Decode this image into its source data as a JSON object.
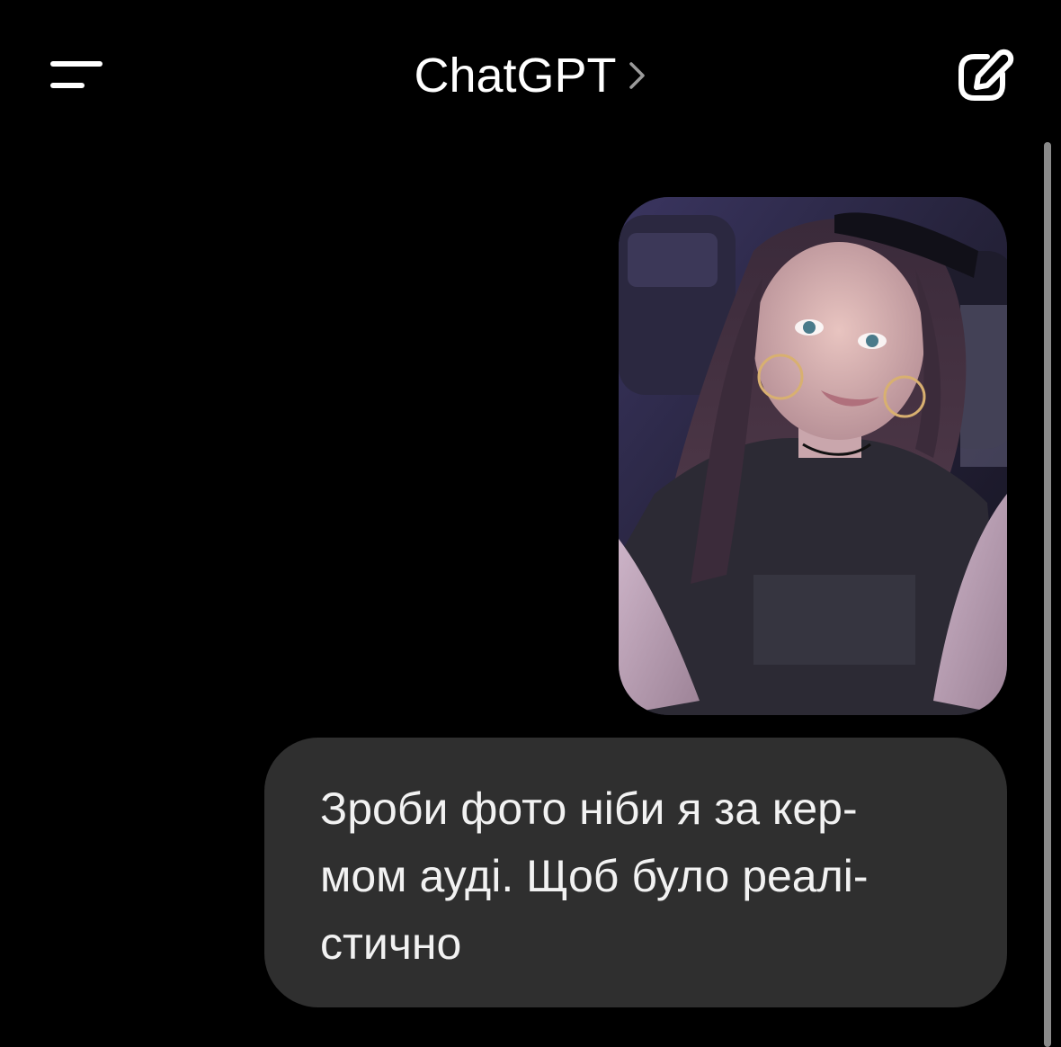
{
  "header": {
    "title": "ChatGPT",
    "menu_icon": "menu-icon",
    "chevron_icon": "chevron-right-icon",
    "new_chat_icon": "edit-icon"
  },
  "conversation": {
    "messages": [
      {
        "role": "user",
        "type": "image",
        "description": ""
      },
      {
        "role": "user",
        "type": "text",
        "text": "Зроби фото ніби я за кер-\nмом ауді. Щоб було реалі-\nстично"
      }
    ]
  },
  "colors": {
    "background": "#000000",
    "bubble": "#2f2f2f",
    "text": "#ffffff",
    "scrollbar": "#8a8a8a"
  }
}
